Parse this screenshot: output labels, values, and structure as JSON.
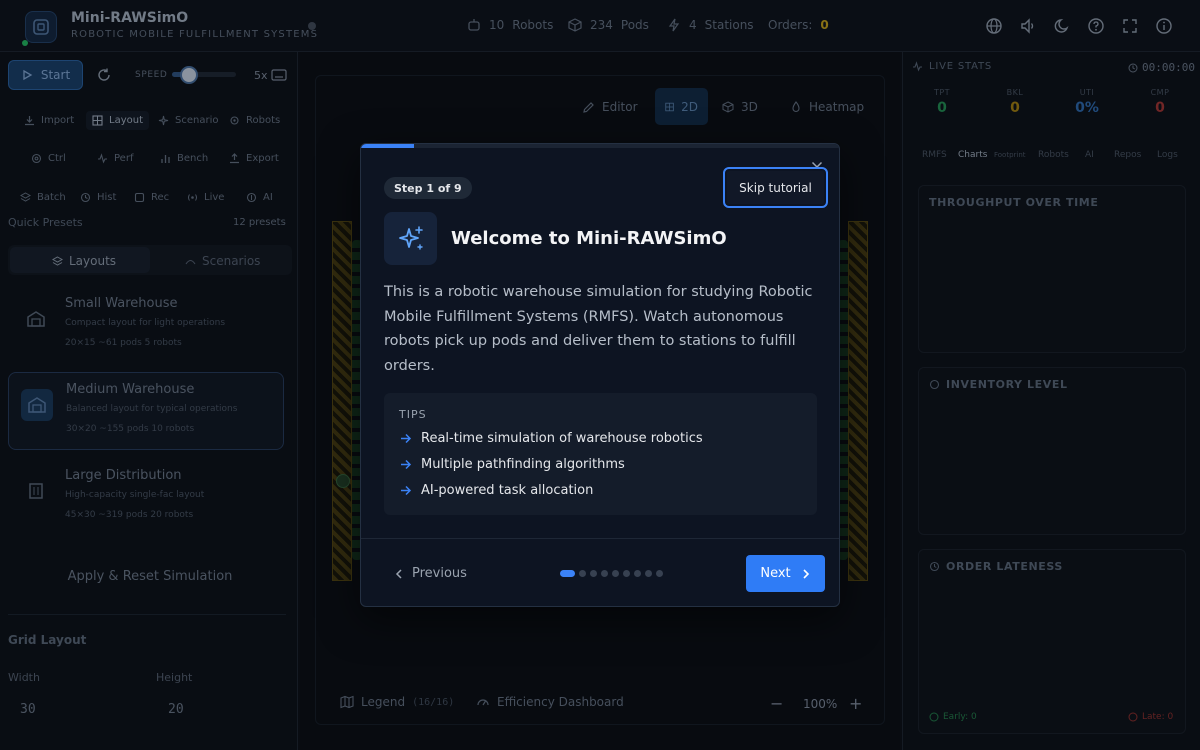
{
  "app": {
    "title": "Mini-RAWSimO",
    "subtitle": "ROBOTIC MOBILE FULFILLMENT SYSTEMS"
  },
  "top_stats": {
    "robots_count": "10",
    "robots_label": "Robots",
    "pods_count": "234",
    "pods_label": "Pods",
    "stations_count": "4",
    "stations_label": "Stations",
    "orders_label": "Orders:",
    "orders_value": "0"
  },
  "controls": {
    "start_label": "Start",
    "speed_label": "SPEED",
    "speed_value": "5x",
    "speed_fraction": 0.28
  },
  "toolbar": {
    "row1": [
      "Import",
      "Layout",
      "Scenario",
      "Robots"
    ],
    "row2": [
      "Ctrl",
      "Perf",
      "Bench",
      "Export"
    ],
    "row3": [
      "Batch",
      "Hist",
      "Rec",
      "Live",
      "AI"
    ]
  },
  "presets": {
    "section_label": "Quick Presets",
    "count_label": "12 presets",
    "tab_layouts": "Layouts",
    "tab_scenarios": "Scenarios",
    "items": [
      {
        "title": "Small Warehouse",
        "desc": "Compact layout for light operations",
        "meta": "20×15  ~61 pods  5 robots"
      },
      {
        "title": "Medium Warehouse",
        "desc": "Balanced layout for typical operations",
        "meta": "30×20  ~155 pods  10 robots"
      },
      {
        "title": "Large Distribution",
        "desc": "High-capacity single-fac layout",
        "meta": "45×30  ~319 pods  20 robots"
      }
    ],
    "apply_label": "Apply & Reset Simulation"
  },
  "grid_layout": {
    "heading": "Grid Layout",
    "width_label": "Width",
    "width_value": "30",
    "height_label": "Height",
    "height_value": "20"
  },
  "view_modes": {
    "editor": "Editor",
    "mode_2d": "2D",
    "mode_3d": "3D",
    "heatmap": "Heatmap"
  },
  "canvas_footer": {
    "legend_label": "Legend",
    "legend_count": "(16/16)",
    "efficiency_label": "Efficiency Dashboard",
    "zoom_minus": "−",
    "zoom_value": "100%",
    "zoom_plus": "+"
  },
  "live_stats": {
    "heading": "LIVE STATS",
    "timer": "00:00:00",
    "kpis": [
      {
        "label": "TPT",
        "value": "0",
        "color": "#1f7a4a"
      },
      {
        "label": "BKL",
        "value": "0",
        "color": "#8a6d12"
      },
      {
        "label": "UTI",
        "value": "0%",
        "color": "#285b96"
      },
      {
        "label": "CMP",
        "value": "0",
        "color": "#8a2f2f"
      }
    ],
    "tabs": [
      "RMFS",
      "Charts",
      "Footprint",
      "Robots",
      "AI",
      "Repos",
      "Logs"
    ],
    "active_tab": "Charts",
    "charts": [
      "THROUGHPUT OVER TIME",
      "INVENTORY LEVEL",
      "ORDER LATENESS"
    ],
    "early_label": "Early: 0",
    "late_label": "Late: 0"
  },
  "tutorial": {
    "step_label": "Step 1 of 9",
    "current_step": 1,
    "total_steps": 9,
    "skip_label": "Skip tutorial",
    "title": "Welcome to Mini-RAWSimO",
    "body": "This is a robotic warehouse simulation for studying Robotic Mobile Fulfillment Systems (RMFS). Watch autonomous robots pick up pods and deliver them to stations to fulfill orders.",
    "tips_heading": "TIPS",
    "tips": [
      "Real-time simulation of warehouse robotics",
      "Multiple pathfinding algorithms",
      "AI-powered task allocation"
    ],
    "previous_label": "Previous",
    "next_label": "Next"
  },
  "colors": {
    "accent": "#3b82f6",
    "modal_bg": "#0d1422",
    "app_bg": "#0b0f16"
  }
}
